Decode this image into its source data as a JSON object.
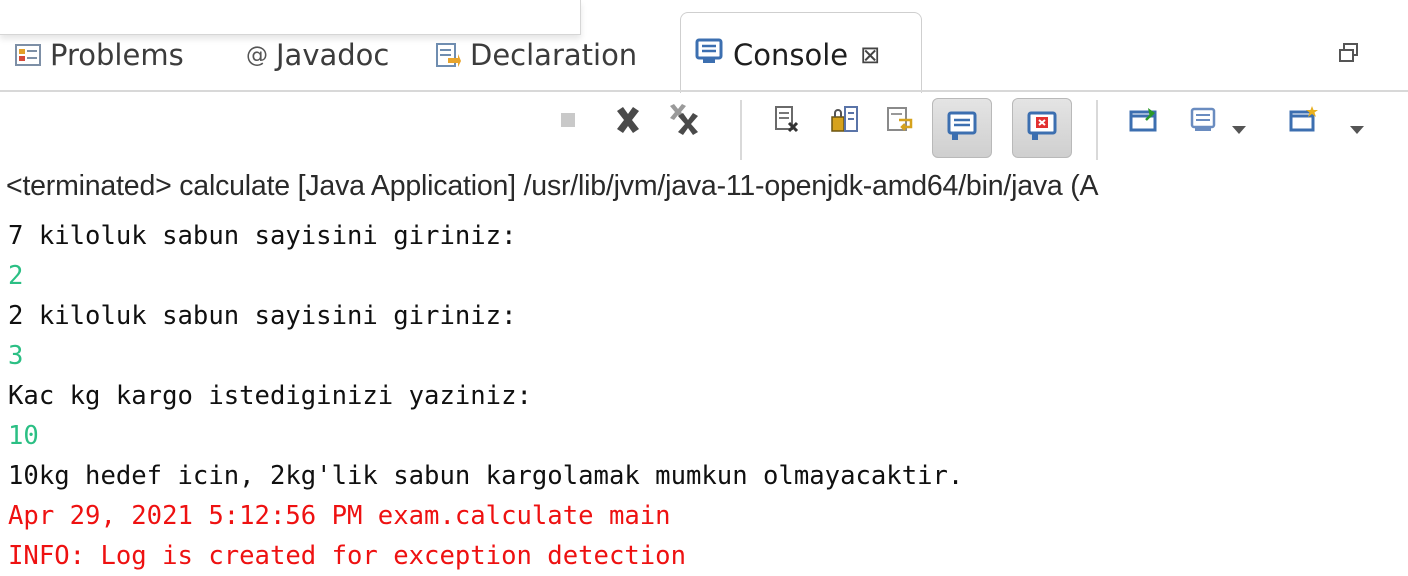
{
  "tabs": {
    "problems": "Problems",
    "javadoc": "Javadoc",
    "declaration": "Declaration",
    "console": "Console",
    "close_glyph": "⊠"
  },
  "toolbar": {
    "icons": [
      "terminate-icon",
      "remove-launch-icon",
      "remove-all-terminated-icon",
      "scroll-lock-icon",
      "word-wrap-icon",
      "pin-console-icon",
      "show-console-on-stdout-icon",
      "show-console-on-stderr-icon",
      "display-selected-console-icon",
      "open-console-icon"
    ]
  },
  "status": "<terminated> calculate [Java Application] /usr/lib/jvm/java-11-openjdk-amd64/bin/java (A",
  "console": {
    "lines": [
      {
        "text": "7 kiloluk sabun sayisini giriniz:",
        "kind": "out"
      },
      {
        "text": "2",
        "kind": "in"
      },
      {
        "text": "2 kiloluk sabun sayisini giriniz:",
        "kind": "out"
      },
      {
        "text": "3",
        "kind": "in"
      },
      {
        "text": "Kac kg kargo istediginizi yaziniz:",
        "kind": "out"
      },
      {
        "text": "10",
        "kind": "in"
      },
      {
        "text": "10kg hedef icin, 2kg'lik sabun kargolamak mumkun olmayacaktir.",
        "kind": "out"
      },
      {
        "text": "Apr 29, 2021 5:12:56 PM exam.calculate main",
        "kind": "err"
      },
      {
        "text": "INFO: Log is created for exception detection",
        "kind": "err"
      }
    ]
  },
  "colors": {
    "stdin": "#2bbf84",
    "stderr": "#ee1111",
    "stdout": "#101010"
  }
}
